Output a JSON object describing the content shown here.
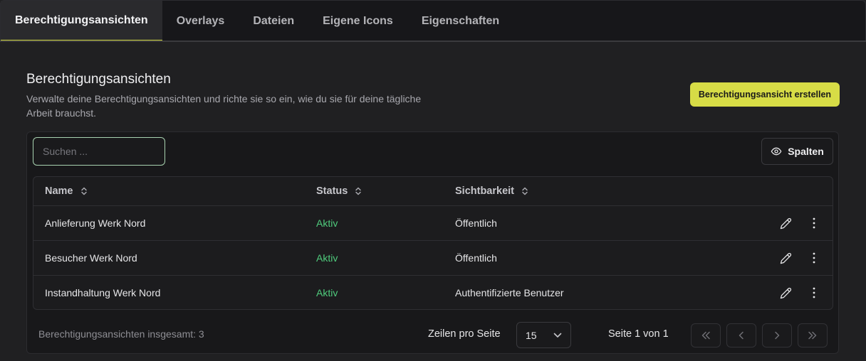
{
  "tabs": [
    {
      "label": "Berechtigungsansichten",
      "active": true
    },
    {
      "label": "Overlays"
    },
    {
      "label": "Dateien"
    },
    {
      "label": "Eigene Icons"
    },
    {
      "label": "Eigenschaften"
    }
  ],
  "header": {
    "title": "Berechtigungsansichten",
    "description": "Verwalte deine Berechtigungsansichten und richte sie so ein, wie du sie für deine tägliche Arbeit brauchst.",
    "create_label": "Berechtigungsansicht erstellen"
  },
  "toolbar": {
    "search_placeholder": "Suchen ...",
    "search_value": "",
    "columns_label": "Spalten",
    "columns_icon": "eye-icon"
  },
  "table": {
    "headers": [
      "Name",
      "Status",
      "Sichtbarkeit"
    ],
    "sort_icon": "sort-updown-icon",
    "rows": [
      {
        "name": "Anlieferung Werk Nord",
        "status": "Aktiv",
        "visibility": "Öffentlich"
      },
      {
        "name": "Besucher Werk Nord",
        "status": "Aktiv",
        "visibility": "Öffentlich"
      },
      {
        "name": "Instandhaltung Werk Nord",
        "status": "Aktiv",
        "visibility": "Authentifizierte Benutzer"
      }
    ],
    "row_actions": [
      "pencil-icon",
      "more-vertical-icon"
    ]
  },
  "footer": {
    "total_label": "Berechtigungsansichten insgesamt: 3",
    "rows_per_page_label": "Zeilen pro Seite",
    "rows_per_page_value": "15",
    "page_info": "Seite 1 von 1",
    "pagination_icons": [
      "first-page-icon",
      "prev-page-icon",
      "next-page-icon",
      "last-page-icon"
    ]
  },
  "colors": {
    "accent": "#d7dc46",
    "status_active": "#4fcb7c",
    "background": "#202022",
    "panel": "#18181a"
  }
}
